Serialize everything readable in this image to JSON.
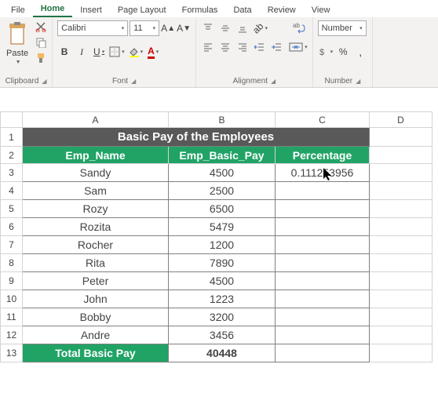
{
  "tabs": [
    "File",
    "Home",
    "Insert",
    "Page Layout",
    "Formulas",
    "Data",
    "Review",
    "View"
  ],
  "active_tab": 1,
  "groups": {
    "clipboard": {
      "label": "Clipboard",
      "paste": "Paste"
    },
    "font": {
      "label": "Font",
      "name": "Calibri",
      "size": "11"
    },
    "alignment": {
      "label": "Alignment"
    },
    "number": {
      "label": "Number",
      "format": "Number"
    }
  },
  "columns": [
    "A",
    "B",
    "C",
    "D"
  ],
  "rows": [
    "1",
    "2",
    "3",
    "4",
    "5",
    "6",
    "7",
    "8",
    "9",
    "10",
    "11",
    "12",
    "13"
  ],
  "sheet": {
    "title": "Basic Pay of the Employees",
    "headers": [
      "Emp_Name",
      "Emp_Basic_Pay",
      "Percentage"
    ],
    "data": [
      {
        "name": "Sandy",
        "pay": "4500",
        "pct": "0.111253956"
      },
      {
        "name": "Sam",
        "pay": "2500",
        "pct": ""
      },
      {
        "name": "Rozy",
        "pay": "6500",
        "pct": ""
      },
      {
        "name": "Rozita",
        "pay": "5479",
        "pct": ""
      },
      {
        "name": "Rocher",
        "pay": "1200",
        "pct": ""
      },
      {
        "name": "Rita",
        "pay": "7890",
        "pct": ""
      },
      {
        "name": "Peter",
        "pay": "4500",
        "pct": ""
      },
      {
        "name": "John",
        "pay": "1223",
        "pct": ""
      },
      {
        "name": "Bobby",
        "pay": "3200",
        "pct": ""
      },
      {
        "name": "Andre",
        "pay": "3456",
        "pct": ""
      }
    ],
    "total_label": "Total Basic Pay",
    "total_value": "40448"
  },
  "chart_data": {
    "type": "table",
    "title": "Basic Pay of the Employees",
    "columns": [
      "Emp_Name",
      "Emp_Basic_Pay",
      "Percentage"
    ],
    "rows": [
      [
        "Sandy",
        4500,
        0.111253956
      ],
      [
        "Sam",
        2500,
        null
      ],
      [
        "Rozy",
        6500,
        null
      ],
      [
        "Rozita",
        5479,
        null
      ],
      [
        "Rocher",
        1200,
        null
      ],
      [
        "Rita",
        7890,
        null
      ],
      [
        "Peter",
        4500,
        null
      ],
      [
        "John",
        1223,
        null
      ],
      [
        "Bobby",
        3200,
        null
      ],
      [
        "Andre",
        3456,
        null
      ]
    ],
    "total": [
      "Total Basic Pay",
      40448,
      null
    ]
  }
}
